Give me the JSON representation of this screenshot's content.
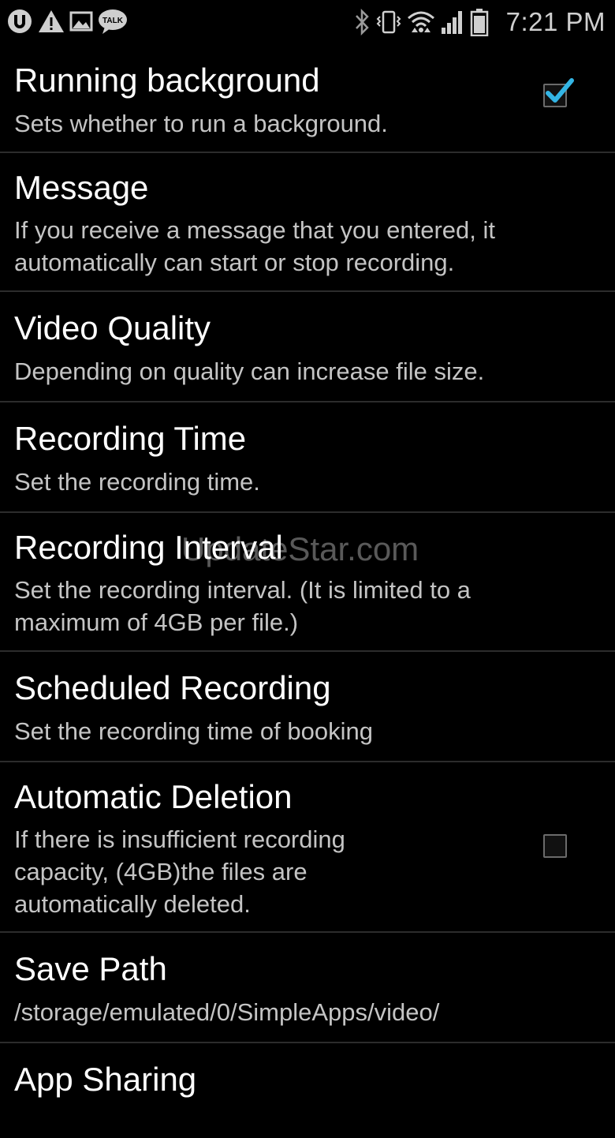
{
  "status_bar": {
    "time": "7:21 PM",
    "left_icons": [
      "u-app-icon",
      "warning-icon",
      "image-icon",
      "talk-icon"
    ],
    "talk_label": "TALK",
    "right_icons": [
      "bluetooth-icon",
      "vibrate-icon",
      "wifi-icon",
      "signal-icon",
      "battery-icon"
    ]
  },
  "preferences": [
    {
      "title": "Running background",
      "summary": "Sets whether to run a background.",
      "checked": true
    },
    {
      "title": "Message",
      "summary": "If you receive a message that you entered, it\nautomatically can start or stop recording."
    },
    {
      "title": "Video Quality",
      "summary": "Depending on quality can increase file size."
    },
    {
      "title": "Recording Time",
      "summary": "Set the recording time."
    },
    {
      "title": "Recording Interval",
      "summary": "Set the recording interval. (It is limited to a\nmaximum of 4GB per file.)"
    },
    {
      "title": "Scheduled Recording",
      "summary": "Set the recording time of booking"
    },
    {
      "title": "Automatic Deletion",
      "summary": "If there is insufficient recording\ncapacity, (4GB)the files are\nautomatically deleted.",
      "checked": false
    },
    {
      "title": "Save Path",
      "summary": "/storage/emulated/0/SimpleApps/video/"
    },
    {
      "title": "App Sharing",
      "summary": ""
    }
  ],
  "watermark": "UpdateStar.com",
  "colors": {
    "background": "#000000",
    "title": "#ffffff",
    "summary": "#c4c4c4",
    "divider": "#2c2c2c",
    "check_accent": "#33b5e5"
  }
}
